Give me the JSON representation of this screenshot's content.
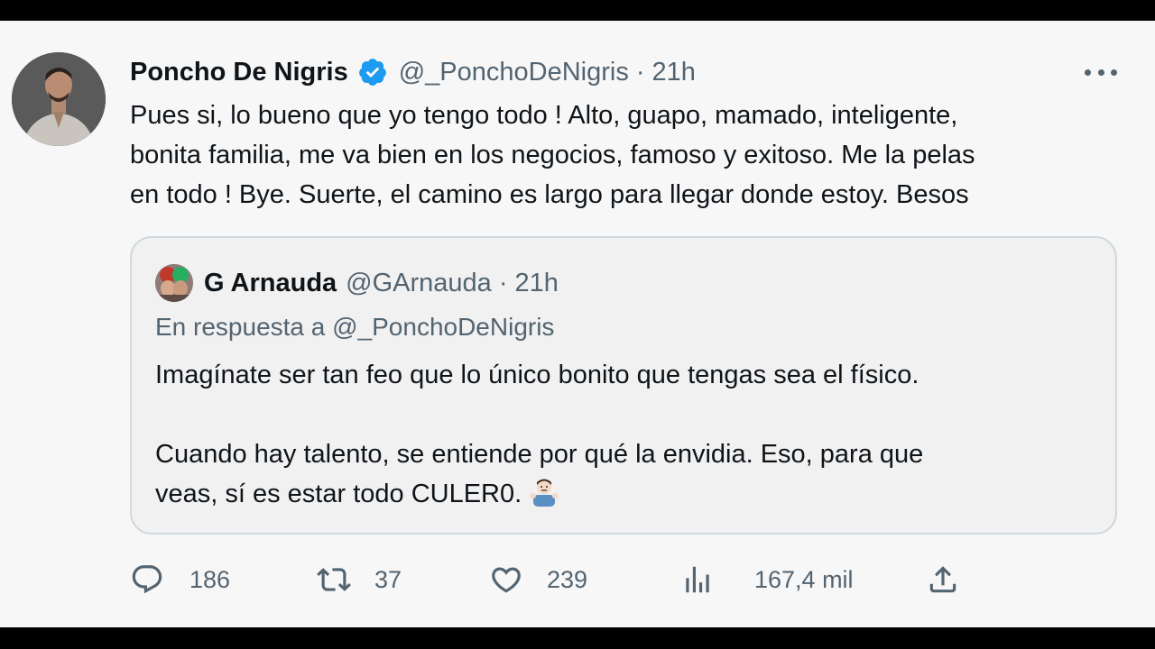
{
  "tweet": {
    "author": {
      "display_name": "Poncho De Nigris",
      "handle": "@_PonchoDeNigris",
      "verified": true
    },
    "time": "21h",
    "separator": "·",
    "text_lines": [
      "Pues si, lo bueno que yo tengo todo ! Alto, guapo, mamado, inteligente,",
      "bonita familia, me va bien en los negocios, famoso y exitoso. Me la pelas",
      "en todo ! Bye. Suerte, el camino es largo para llegar donde estoy. Besos"
    ],
    "more_icon": "more-horizontal-icon"
  },
  "quote": {
    "author": {
      "display_name": "G Arnauda",
      "handle": "@GArnauda"
    },
    "time": "21h",
    "separator": "·",
    "reply_to": "En respuesta a @_PonchoDeNigris",
    "paragraph1": "Imagínate ser tan feo que lo único bonito que tengas sea el físico.",
    "paragraph2_line1": "Cuando hay talento, se entiende por qué la envidia. Eso, para que",
    "paragraph2_line2": "veas, sí es estar todo CULER0.",
    "emoji": "man-shrugging-emoji"
  },
  "actions": {
    "reply": {
      "icon": "reply-icon",
      "count": "186"
    },
    "retweet": {
      "icon": "retweet-icon",
      "count": "37"
    },
    "like": {
      "icon": "heart-icon",
      "count": "239"
    },
    "views": {
      "icon": "views-chart-icon",
      "count": "167,4 mil"
    },
    "share": {
      "icon": "share-icon"
    }
  },
  "colors": {
    "text": "#0f1419",
    "muted": "#536471",
    "verified": "#1d9bf0",
    "border": "#cfd9de"
  }
}
